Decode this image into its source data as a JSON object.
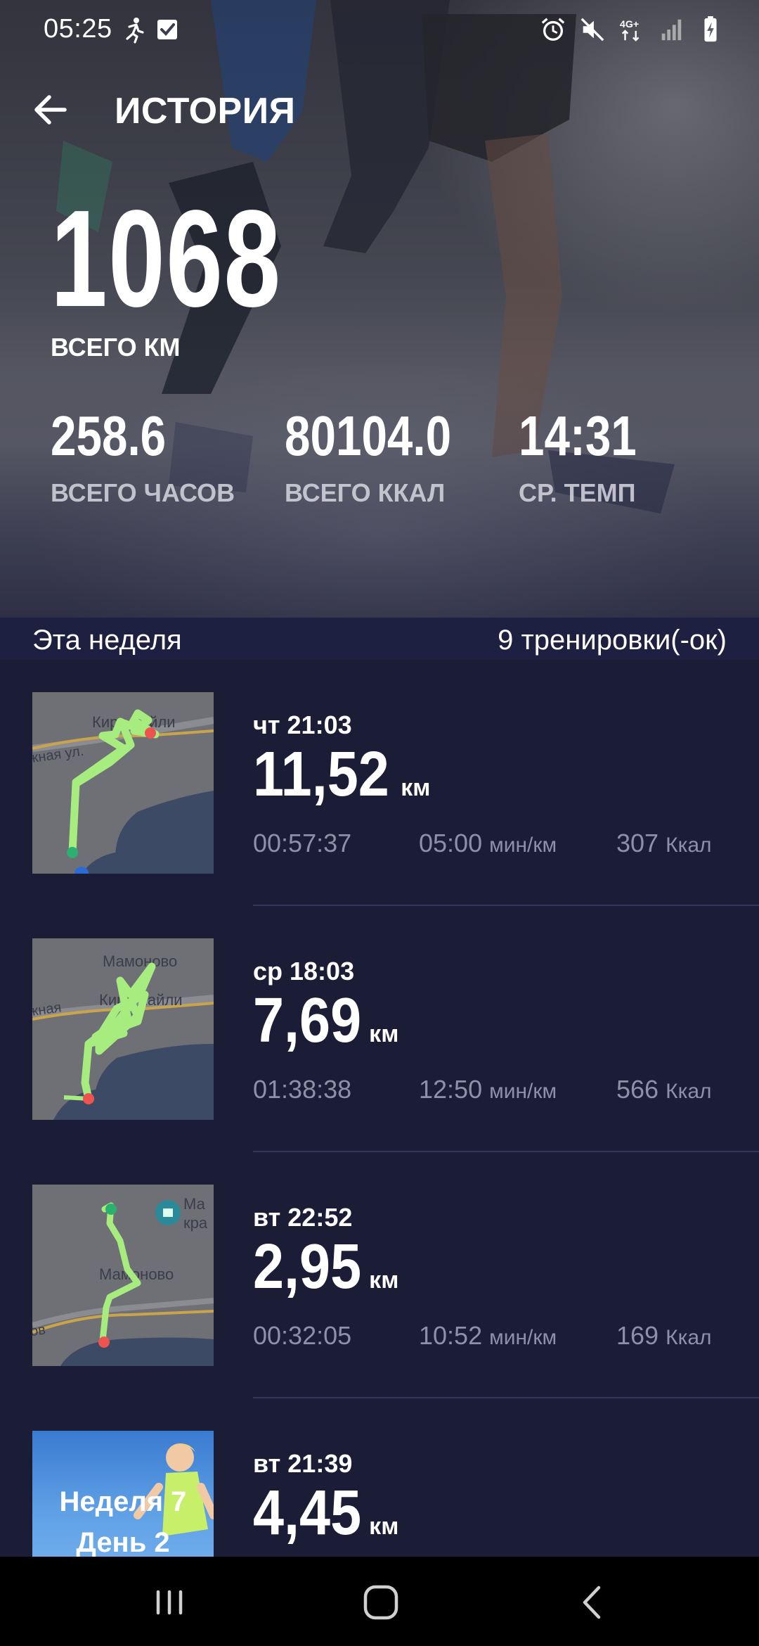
{
  "status_bar": {
    "time": "05:25",
    "network": "4G+",
    "left_icons": [
      "running-figure-icon",
      "checkbox-icon"
    ],
    "right_icons": [
      "alarm-icon",
      "mute-icon",
      "network-4g-icon",
      "signal-icon",
      "battery-charging-icon"
    ]
  },
  "header": {
    "title": "ИСТОРИЯ",
    "back_icon": "arrow-left-icon"
  },
  "totals": {
    "km_value": "1068",
    "km_label": "ВСЕГО КМ",
    "hours_value": "258.6",
    "hours_label": "ВСЕГО ЧАСОВ",
    "kcal_value": "80104.0",
    "kcal_label": "ВСЕГО ККАЛ",
    "pace_value": "14:31",
    "pace_label": "СР. ТЕМП"
  },
  "week": {
    "title": "Эта неделя",
    "count": "9 тренировки(-ок)"
  },
  "workouts": [
    {
      "time": "чт 21:03",
      "distance": "11,52",
      "unit": "км",
      "duration": "00:57:37",
      "pace": "05:00",
      "pace_unit": "мин/км",
      "kcal": "307",
      "kcal_unit": "Ккал",
      "map_labels": [
        "Кирх Хайли",
        "жная ул."
      ]
    },
    {
      "time": "ср 18:03",
      "distance": "7,69",
      "unit": "км",
      "duration": "01:38:38",
      "pace": "12:50",
      "pace_unit": "мин/км",
      "kcal": "566",
      "kcal_unit": "Ккал",
      "map_labels": [
        "Мамоново",
        "Кирх Хайли",
        "жная"
      ]
    },
    {
      "time": "вт 22:52",
      "distance": "2,95",
      "unit": "км",
      "duration": "00:32:05",
      "pace": "10:52",
      "pace_unit": "мин/км",
      "kcal": "169",
      "kcal_unit": "Ккал",
      "map_labels": [
        "Ма",
        "кра",
        "Мамоново",
        "ов"
      ]
    },
    {
      "time": "вт 21:39",
      "distance": "4,45",
      "unit": "км",
      "promo_line1": "Неделя 7",
      "promo_line2": "День 2"
    }
  ],
  "colors": {
    "background": "#1b1c36",
    "route": "#a6ec7e",
    "start_point": "#2ab06f",
    "end_point": "#ef5350",
    "muted_text": "#8f90a8",
    "nav_bar": "#000000"
  },
  "nav": {
    "icons": [
      "recent-apps-icon",
      "home-icon",
      "back-nav-icon"
    ]
  }
}
